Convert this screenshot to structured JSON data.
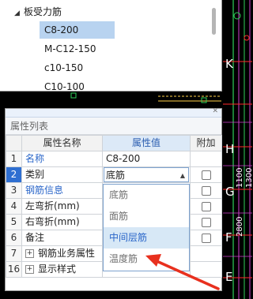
{
  "tree": {
    "parent_label": "板受力筋",
    "items": [
      {
        "label": "C8-200",
        "selected": true
      },
      {
        "label": "M-C12-150",
        "selected": false
      },
      {
        "label": "c10-150",
        "selected": false
      },
      {
        "label": "C10-100",
        "selected": false
      }
    ]
  },
  "property_panel": {
    "title": "属性列表",
    "columns": [
      "属性名称",
      "属性值",
      "附加"
    ],
    "rows": [
      {
        "index": "1",
        "name": "名称",
        "value": "C8-200",
        "has_checkbox": false
      },
      {
        "index": "2",
        "name": "类别",
        "value": "底筋",
        "has_checkbox": true
      },
      {
        "index": "3",
        "name": "钢筋信息",
        "value": "",
        "has_checkbox": true
      },
      {
        "index": "4",
        "name": "左弯折(mm)",
        "value": "",
        "has_checkbox": true
      },
      {
        "index": "5",
        "name": "右弯折(mm)",
        "value": "",
        "has_checkbox": true
      },
      {
        "index": "6",
        "name": "备注",
        "value": "",
        "has_checkbox": true
      },
      {
        "index": "7",
        "name": "钢筋业务属性",
        "value": "",
        "has_checkbox": false
      },
      {
        "index": "16",
        "name": "显示样式",
        "value": "",
        "has_checkbox": false
      }
    ],
    "expander_symbol": "+"
  },
  "dropdown": {
    "options": [
      "底筋",
      "面筋",
      "中间层筋",
      "温度筋"
    ],
    "hovered": "中间层筋"
  },
  "cad_labels": [
    "K",
    "H",
    "G",
    "F",
    "E",
    "1100",
    "2800",
    "1300"
  ],
  "colors": {
    "annotation_red": "#e8301e",
    "selection_blue": "#2f6fd1",
    "cad_green": "#2fd15a",
    "cad_red": "#ff2a2a",
    "cad_magenta": "#d040d0"
  }
}
